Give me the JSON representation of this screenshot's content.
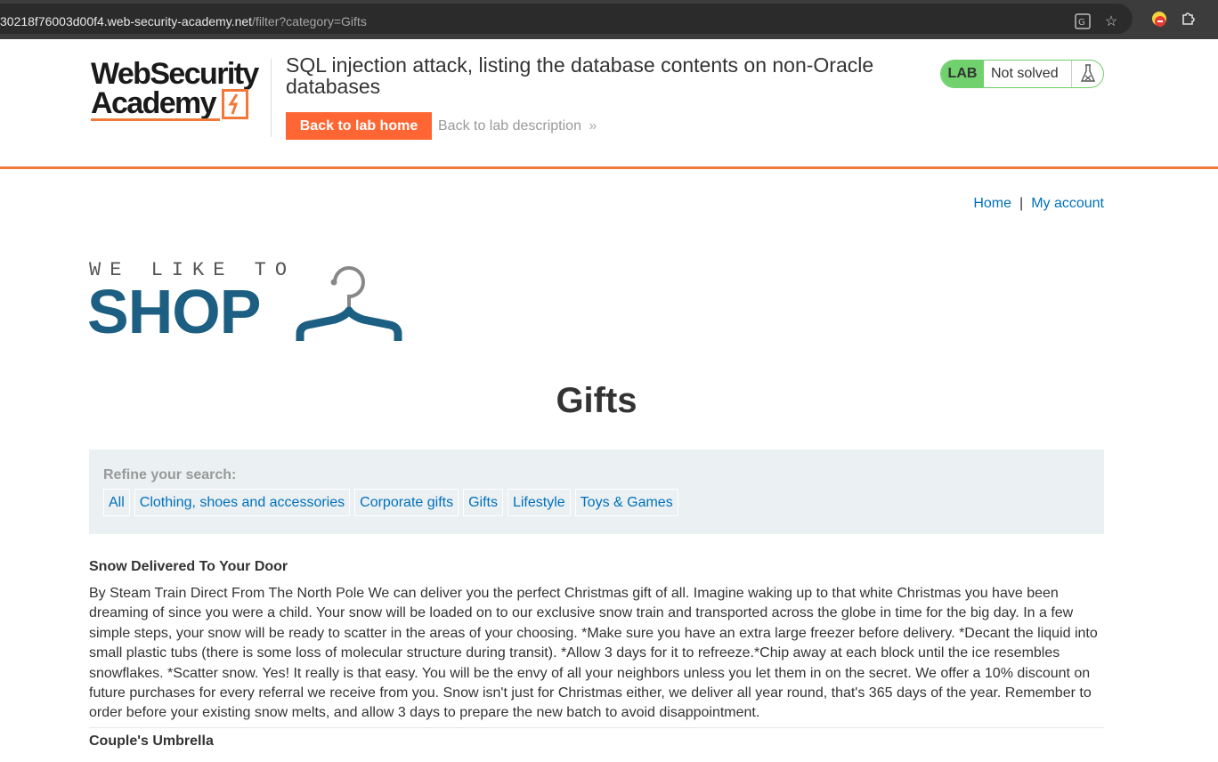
{
  "browser": {
    "url_host": "30218f76003d00f4.web-security-academy.net",
    "url_path": "/filter?category=Gifts",
    "icons": [
      "translate-icon",
      "bookmark-star-icon",
      "extension-icon",
      "extensions-puzzle-icon"
    ]
  },
  "lab_header": {
    "logo_line1": "WebSecurity",
    "logo_line2": "Academy",
    "title": "SQL injection attack, listing the database contents on non-Oracle databases",
    "back_home_label": "Back to lab home",
    "back_description_label": "Back to lab description",
    "status_badge": "LAB",
    "status_text": "Not solved",
    "colors": {
      "accent": "#ff6633",
      "status": "#70d16d"
    }
  },
  "nav": {
    "home": "Home",
    "separator": "|",
    "my_account": "My account"
  },
  "shop_logo": {
    "tagline": "WE LIKE TO",
    "word": "SHOP",
    "color": "#1c5f82"
  },
  "page": {
    "title": "Gifts"
  },
  "filter": {
    "label": "Refine your search:",
    "categories": [
      "All",
      "Clothing, shoes and accessories",
      "Corporate gifts",
      "Gifts",
      "Lifestyle",
      "Toys & Games"
    ]
  },
  "products": [
    {
      "title": "Snow Delivered To Your Door",
      "description": "By Steam Train Direct From The North Pole We can deliver you the perfect Christmas gift of all. Imagine waking up to that white Christmas you have been dreaming of since you were a child. Your snow will be loaded on to our exclusive snow train and transported across the globe in time for the big day. In a few simple steps, your snow will be ready to scatter in the areas of your choosing. *Make sure you have an extra large freezer before delivery. *Decant the liquid into small plastic tubs (there is some loss of molecular structure during transit). *Allow 3 days for it to refreeze.*Chip away at each block until the ice resembles snowflakes. *Scatter snow. Yes! It really is that easy. You will be the envy of all your neighbors unless you let them in on the secret. We offer a 10% discount on future purchases for every referral we receive from you. Snow isn't just for Christmas either, we deliver all year round, that's 365 days of the year. Remember to order before your existing snow melts, and allow 3 days to prepare the new batch to avoid disappointment."
    },
    {
      "title": "Couple's Umbrella",
      "description": ""
    }
  ]
}
